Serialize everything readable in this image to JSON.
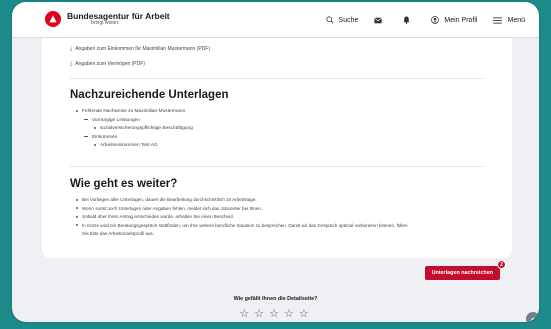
{
  "header": {
    "logo_name": "Bundesagentur für Arbeit",
    "logo_slogan": "bringt weiter.",
    "search_label": "Suche",
    "profile_label": "Mein Profil",
    "menu_label": "Menü"
  },
  "downloads": [
    {
      "label": "Angaben zum Einkommen für Maximilian Mustermann (PDF)"
    },
    {
      "label": "Angaben zum Vermögen (PDF)"
    }
  ],
  "missing_docs": {
    "title": "Nachzureichende Unterlagen",
    "items": [
      {
        "level": 1,
        "text": "Fehlende Nachweise zu Maximilian Mustermann"
      },
      {
        "level": 2,
        "text": "Vorrangige Leistungen"
      },
      {
        "level": 3,
        "text": "sozialversicherungspflichtige Beschäftigung"
      },
      {
        "level": 2,
        "text": "Einkommen"
      },
      {
        "level": 3,
        "text": "Arbeitseinkommen Test AG"
      }
    ]
  },
  "next_steps": {
    "title": "Wie geht es weiter?",
    "items": [
      "Bei Vorliegen aller Unterlagen, dauert die Bearbeitung durchschnittlich 10 Arbeitstage.",
      "Wenn sonst noch Unterlagen oder Angaben fehlen, meldet sich das Jobcenter bei Ihnen.",
      "Sobald über Ihren Antrag entschieden wurde, erhalten Sie einen Bescheid.",
      "In Kürze wird ein Beratungsgespräch stattfinden, um Ihre weitere berufliche Situation zu besprechen. Damit wir das Gespräch optimal vorbereiten können, füllen"
    ],
    "continuation": "Sie bitte das Arbeitsmarktprofil aus."
  },
  "action": {
    "upload_label": "Unterlagen nachreichen",
    "badge_count": "2"
  },
  "rating": {
    "question": "Wie gefällt Ihnen die Detailseite?",
    "star_glyph": "☆",
    "max_stars": 5
  },
  "colors": {
    "brand_red": "#e2001a",
    "button_red": "#c30e2e",
    "background_teal": "#1d8b8a"
  }
}
